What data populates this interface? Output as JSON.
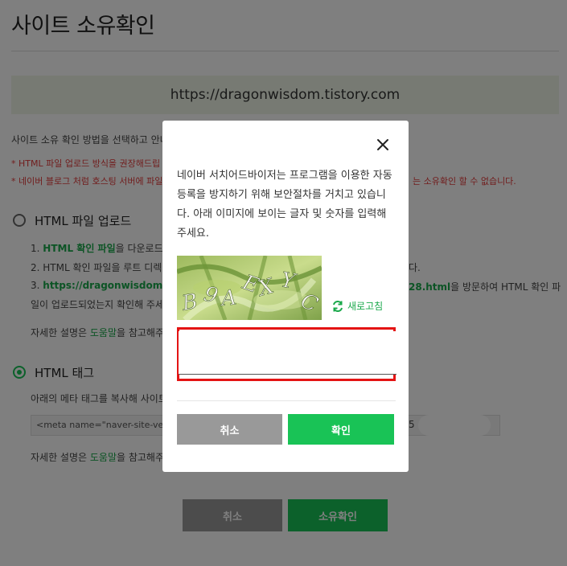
{
  "page": {
    "title": "사이트 소유확인",
    "site_url": "https://dragonwisdom.tistory.com",
    "intro": "사이트 소유 확인 방법을 선택하고 안내",
    "warnings": [
      "* HTML 파일 업로드 방식을 권장해드립",
      "* 네이버 블로그 처럼 호스팅 서버에 파일"
    ],
    "warning_tail": "는 소유확인 할 수 없습니다.",
    "option_html_file": {
      "label": "HTML 파일 업로드",
      "step1_num": "1.",
      "step1_link": "HTML 확인 파일",
      "step1_rest": "을 다운로드합",
      "step2": "2. HTML 확인 파일을 루트 디렉",
      "step2_tail": "다.",
      "step3_num": "3.",
      "step3_link": "https://dragonwisdom.tis",
      "step3_link_tail": "28.html",
      "step3_rest": "을 방문하여 HTML 확인 파",
      "step3_line2": "일이 업로드되었는지 확인해 주세",
      "help_prefix": "자세한 설명은 ",
      "help_link": "도움말",
      "help_suffix": "을 참고해주"
    },
    "option_html_tag": {
      "label": "HTML 태그",
      "desc": "아래의 메타 태그를 복사해 사이트",
      "meta_snippet": "<meta name=\"naver-site-ve",
      "meta_tail": "5",
      "help_prefix": "자세한 설명은 ",
      "help_link": "도움말",
      "help_suffix": "을 참고해주"
    },
    "cancel_label": "취소",
    "confirm_label": "소유확인"
  },
  "modal": {
    "description": "네이버 서치어드바이저는 프로그램을 이용한 자동등록을 방지하기 위해 보안절차를 거치고 있습니다. 아래 이미지에 보이는 글자 및 숫자를 입력해주세요.",
    "captcha_text": "B9AEXYC",
    "refresh_label": "새로고침",
    "input_value": "",
    "input_placeholder": "",
    "cancel_label": "취소",
    "ok_label": "확인"
  },
  "colors": {
    "accent": "#19c356",
    "warning": "#e23b3b",
    "highlight": "#e41414"
  },
  "icons": {
    "close": "close-icon",
    "refresh": "refresh-icon"
  }
}
